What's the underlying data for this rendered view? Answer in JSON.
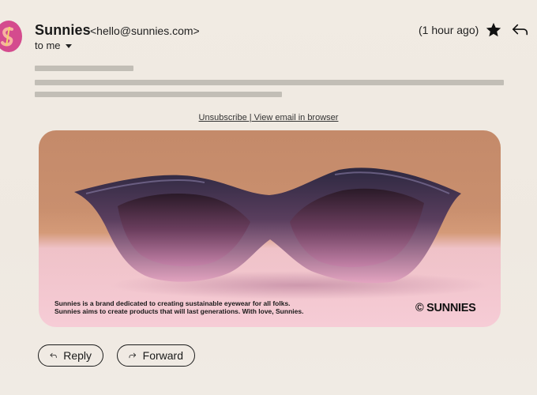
{
  "header": {
    "sender_name": "Sunnies",
    "sender_email": "<hello@sunnies.com>",
    "recipient": "to me",
    "time": "(1 hour ago)",
    "avatar_icon": "sunnies-logo-icon",
    "star_icon": "star-icon",
    "reply_icon": "reply-arrow-icon",
    "brand_color": "#d44b8e"
  },
  "body": {
    "links": "Unsubscribe | View email in  browser",
    "caption_line1": "Sunnies is a brand dedicated to creating sustainable eyewear for all folks.",
    "caption_line2": "Sunnies aims to create products that will last generations. With love, Sunnies.",
    "logo_text": "© SUNNIES"
  },
  "actions": {
    "reply_label": "Reply",
    "forward_label": "Forward"
  }
}
